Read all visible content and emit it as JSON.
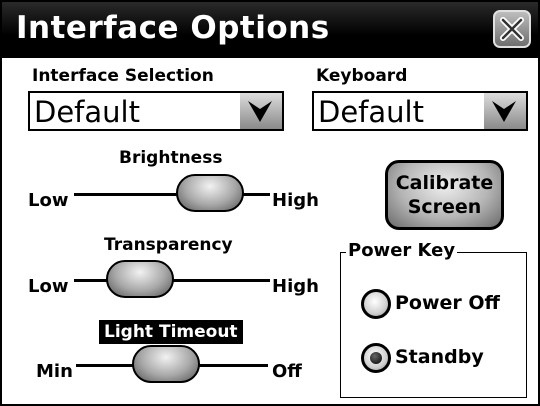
{
  "window": {
    "title": "Interface Options",
    "close_icon": "close-x-icon"
  },
  "interface_selection": {
    "label": "Interface Selection",
    "value": "Default",
    "arrow_icon": "chevron-down-icon"
  },
  "keyboard": {
    "label": "Keyboard",
    "value": "Default",
    "arrow_icon": "chevron-down-icon"
  },
  "brightness": {
    "label": "Brightness",
    "min_label": "Low",
    "max_label": "High",
    "level": 0.8
  },
  "transparency": {
    "label": "Transparency",
    "min_label": "Low",
    "max_label": "High",
    "level": 0.25
  },
  "light_timeout": {
    "label": "Light Timeout",
    "min_label": "Min",
    "max_label": "Off",
    "level": 0.45
  },
  "calibrate": {
    "line1": "Calibrate",
    "line2": "Screen"
  },
  "power_key": {
    "label": "Power Key",
    "options": [
      {
        "label": "Power Off",
        "selected": false
      },
      {
        "label": "Standby",
        "selected": true
      }
    ]
  },
  "colors": {
    "titlebar": "#000000",
    "background": "#ffffff",
    "control_gray": "#a8a8a8"
  }
}
